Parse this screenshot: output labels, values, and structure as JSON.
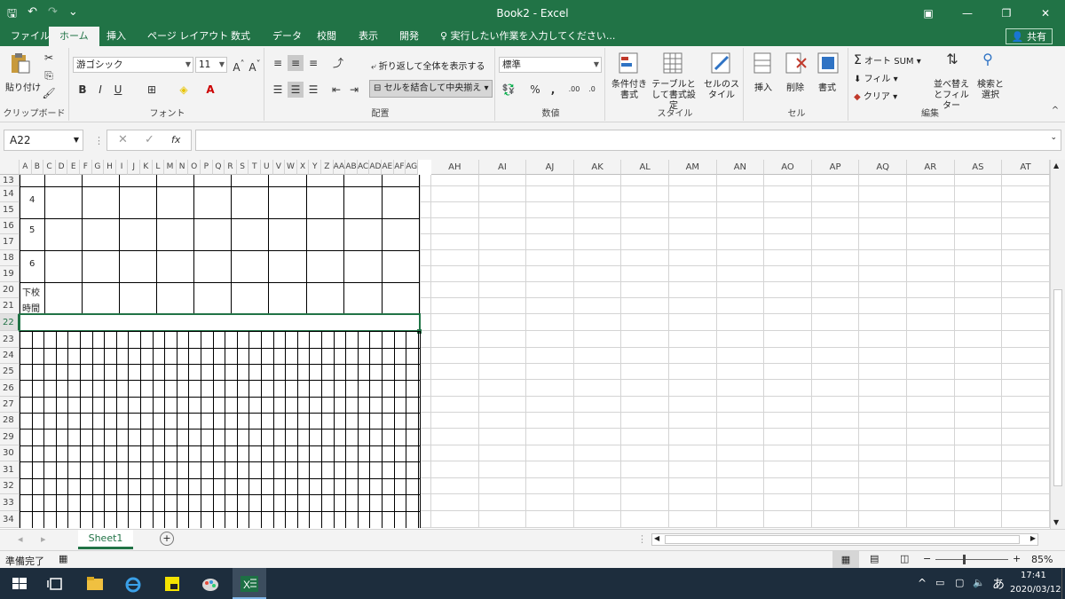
{
  "window": {
    "title": "Book2 - Excel"
  },
  "tabs": [
    "ファイル",
    "ホーム",
    "挿入",
    "ページ レイアウト",
    "数式",
    "データ",
    "校閲",
    "表示",
    "開発"
  ],
  "active_tab": "ホーム",
  "tell_me": "実行したい作業を入力してください...",
  "share_label": "共有",
  "clipboard": {
    "paste": "貼り付け",
    "group": "クリップボード"
  },
  "font": {
    "name": "游ゴシック",
    "size": "11",
    "bold": "B",
    "italic": "I",
    "underline": "U",
    "group": "フォント"
  },
  "alignment": {
    "wrap": "折り返して全体を表示する",
    "merge": "セルを結合して中央揃え",
    "group": "配置"
  },
  "number": {
    "format": "標準",
    "group": "数値"
  },
  "styles": {
    "conditional": "条件付き書式",
    "as_table": "テーブルとして書式設定",
    "cell_styles": "セルのスタイル",
    "group": "スタイル"
  },
  "cells": {
    "insert": "挿入",
    "delete": "削除",
    "format": "書式",
    "group": "セル"
  },
  "editing": {
    "autosum": "オート SUM",
    "fill": "フィル",
    "clear": "クリア",
    "sort": "並べ替えとフィルター",
    "find": "検索と選択",
    "group": "編集"
  },
  "formula_bar": {
    "name_box": "A22",
    "fx": "fx",
    "content": ""
  },
  "narrow_columns": [
    "A",
    "B",
    "C",
    "D",
    "E",
    "F",
    "G",
    "H",
    "I",
    "J",
    "K",
    "L",
    "M",
    "N",
    "O",
    "P",
    "Q",
    "R",
    "S",
    "T",
    "U",
    "V",
    "W",
    "X",
    "Y",
    "Z",
    "AA",
    "AB",
    "AC",
    "AD",
    "AE",
    "AF",
    "AG"
  ],
  "wide_columns": [
    "AH",
    "AI",
    "AJ",
    "AK",
    "AL",
    "AM",
    "AN",
    "AO",
    "AP",
    "AQ",
    "AR",
    "AS",
    "AT"
  ],
  "rows": [
    "13",
    "14",
    "15",
    "16",
    "17",
    "18",
    "19",
    "20",
    "21",
    "22",
    "23",
    "24",
    "25",
    "26",
    "27",
    "28",
    "29",
    "30",
    "31",
    "32",
    "33",
    "34"
  ],
  "selected_row": "22",
  "cell_text": {
    "period_4": "4",
    "period_5": "5",
    "period_6": "6",
    "dismissal_1": "下校",
    "dismissal_2": "時間"
  },
  "sheet": {
    "name": "Sheet1"
  },
  "status": {
    "ready": "準備完了",
    "zoom": "85%"
  },
  "clock": {
    "time": "17:41",
    "date": "2020/03/12",
    "ime": "あ"
  },
  "colors": {
    "excel_green": "#217346",
    "taskbar": "#1d2d3d"
  }
}
